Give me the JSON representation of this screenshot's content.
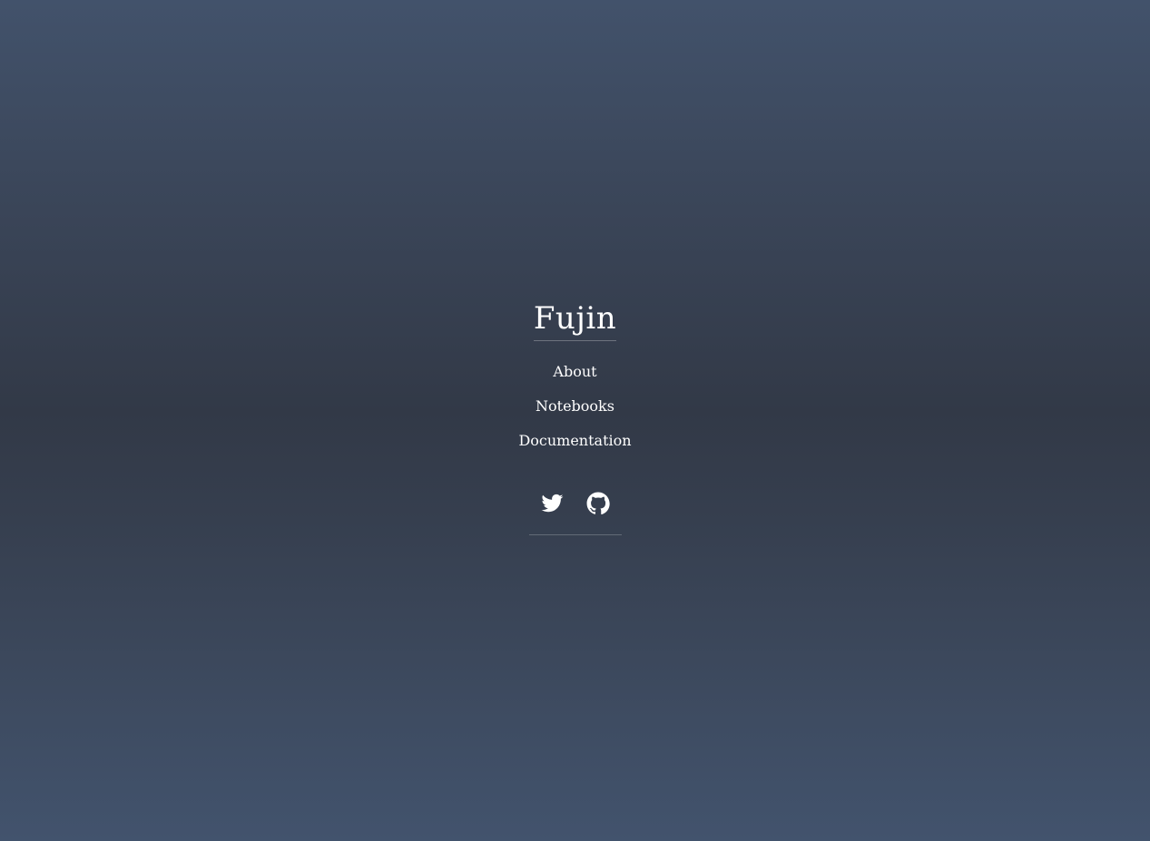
{
  "site": {
    "title": "Fujin"
  },
  "nav": {
    "items": [
      {
        "label": "About"
      },
      {
        "label": "Notebooks"
      },
      {
        "label": "Documentation"
      }
    ]
  },
  "social": {
    "links": [
      {
        "icon": "twitter-icon"
      },
      {
        "icon": "github-icon"
      }
    ]
  },
  "colors": {
    "text": "#ffffff",
    "background_top": "#42526b",
    "background_middle": "#323947",
    "background_bottom": "#42536d"
  }
}
